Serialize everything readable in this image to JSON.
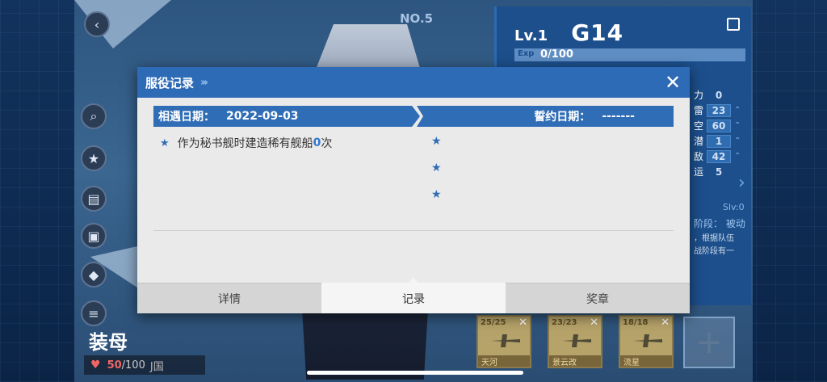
{
  "background": {
    "top_number": "NO.5",
    "right_panel": {
      "level": "Lv.1",
      "ship_name": "G14",
      "exp_label": "Exp",
      "exp_value": "0/100",
      "stats": [
        {
          "label": "力",
          "value": "0",
          "boxed": false
        },
        {
          "label": "雷",
          "value": "23",
          "boxed": true
        },
        {
          "label": "空",
          "value": "60",
          "boxed": true
        },
        {
          "label": "潜",
          "value": "1",
          "boxed": true
        },
        {
          "label": "敌",
          "value": "42",
          "boxed": true
        },
        {
          "label": "运",
          "value": "5",
          "boxed": false
        }
      ],
      "slv": "Slv:0",
      "phase": "阶段：  被动",
      "phase_note_1": "，根据队伍",
      "phase_note_2": "战阶段有一"
    },
    "ship_type": "装母",
    "hp_current": "50",
    "hp_max": "/100",
    "nation": "J国",
    "planes": [
      {
        "count": "25/25",
        "name": "天河"
      },
      {
        "count": "23/23",
        "name": "景云改"
      },
      {
        "count": "18/18",
        "name": "流星"
      }
    ]
  },
  "modal": {
    "title": "服役记录",
    "title_arrows": "›››",
    "close_glyph": "✕",
    "meet_date_label": "相遇日期：",
    "meet_date_value": "2022-09-03",
    "oath_date_label": "誓约日期：",
    "oath_date_value": "-------",
    "records": [
      {
        "prefix": "作为秘书舰时建造稀有舰船",
        "count": "0",
        "suffix": "次"
      }
    ],
    "tabs": [
      {
        "label": "详情",
        "active": false
      },
      {
        "label": "记录",
        "active": true
      },
      {
        "label": "奖章",
        "active": false
      }
    ]
  }
}
